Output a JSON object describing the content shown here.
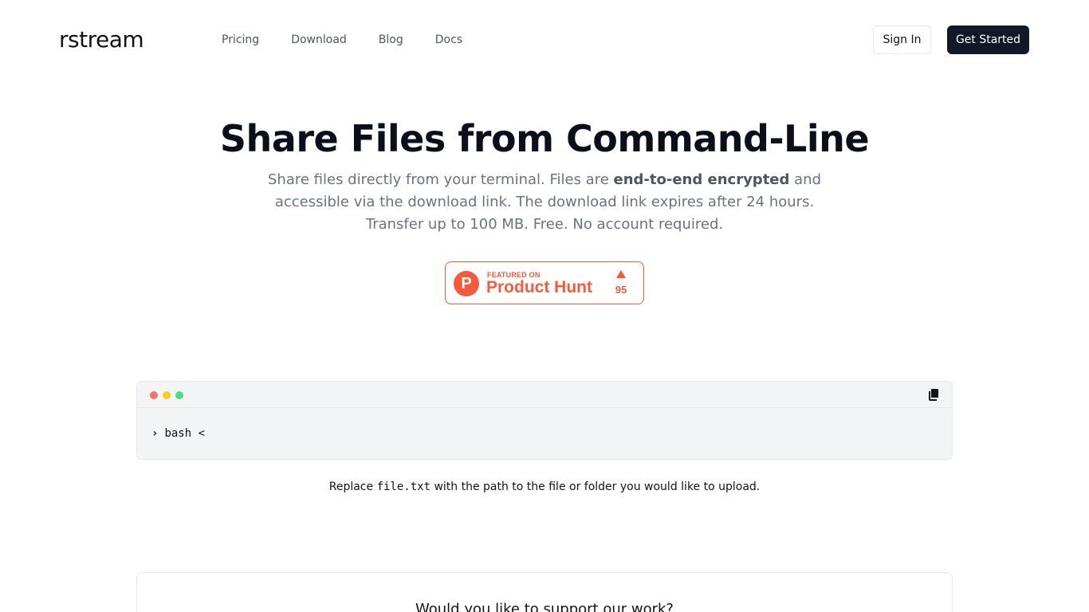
{
  "header": {
    "logo": "rstream",
    "nav": [
      "Pricing",
      "Download",
      "Blog",
      "Docs"
    ],
    "sign_in": "Sign In",
    "get_started": "Get Started"
  },
  "hero": {
    "title": "Share Files from Command-Line",
    "subtitle_pre": "Share files directly from your terminal. Files are ",
    "subtitle_bold": "end-to-end encrypted",
    "subtitle_post": " and accessible via the download link. The download link expires after 24 hours. Transfer up to 100 MB. Free. No account required."
  },
  "product_hunt": {
    "letter": "P",
    "featured": "FEATURED ON",
    "name": "Product Hunt",
    "count": "95",
    "color": "#f55a3c"
  },
  "terminal": {
    "prompt": "›",
    "command": "bash <",
    "copy_icon": "copy-icon"
  },
  "note": {
    "pre": "Replace ",
    "code": "file.txt",
    "post": " with the path to the file or folder you would like to upload."
  },
  "support": {
    "title": "Would you like to support our work?"
  }
}
